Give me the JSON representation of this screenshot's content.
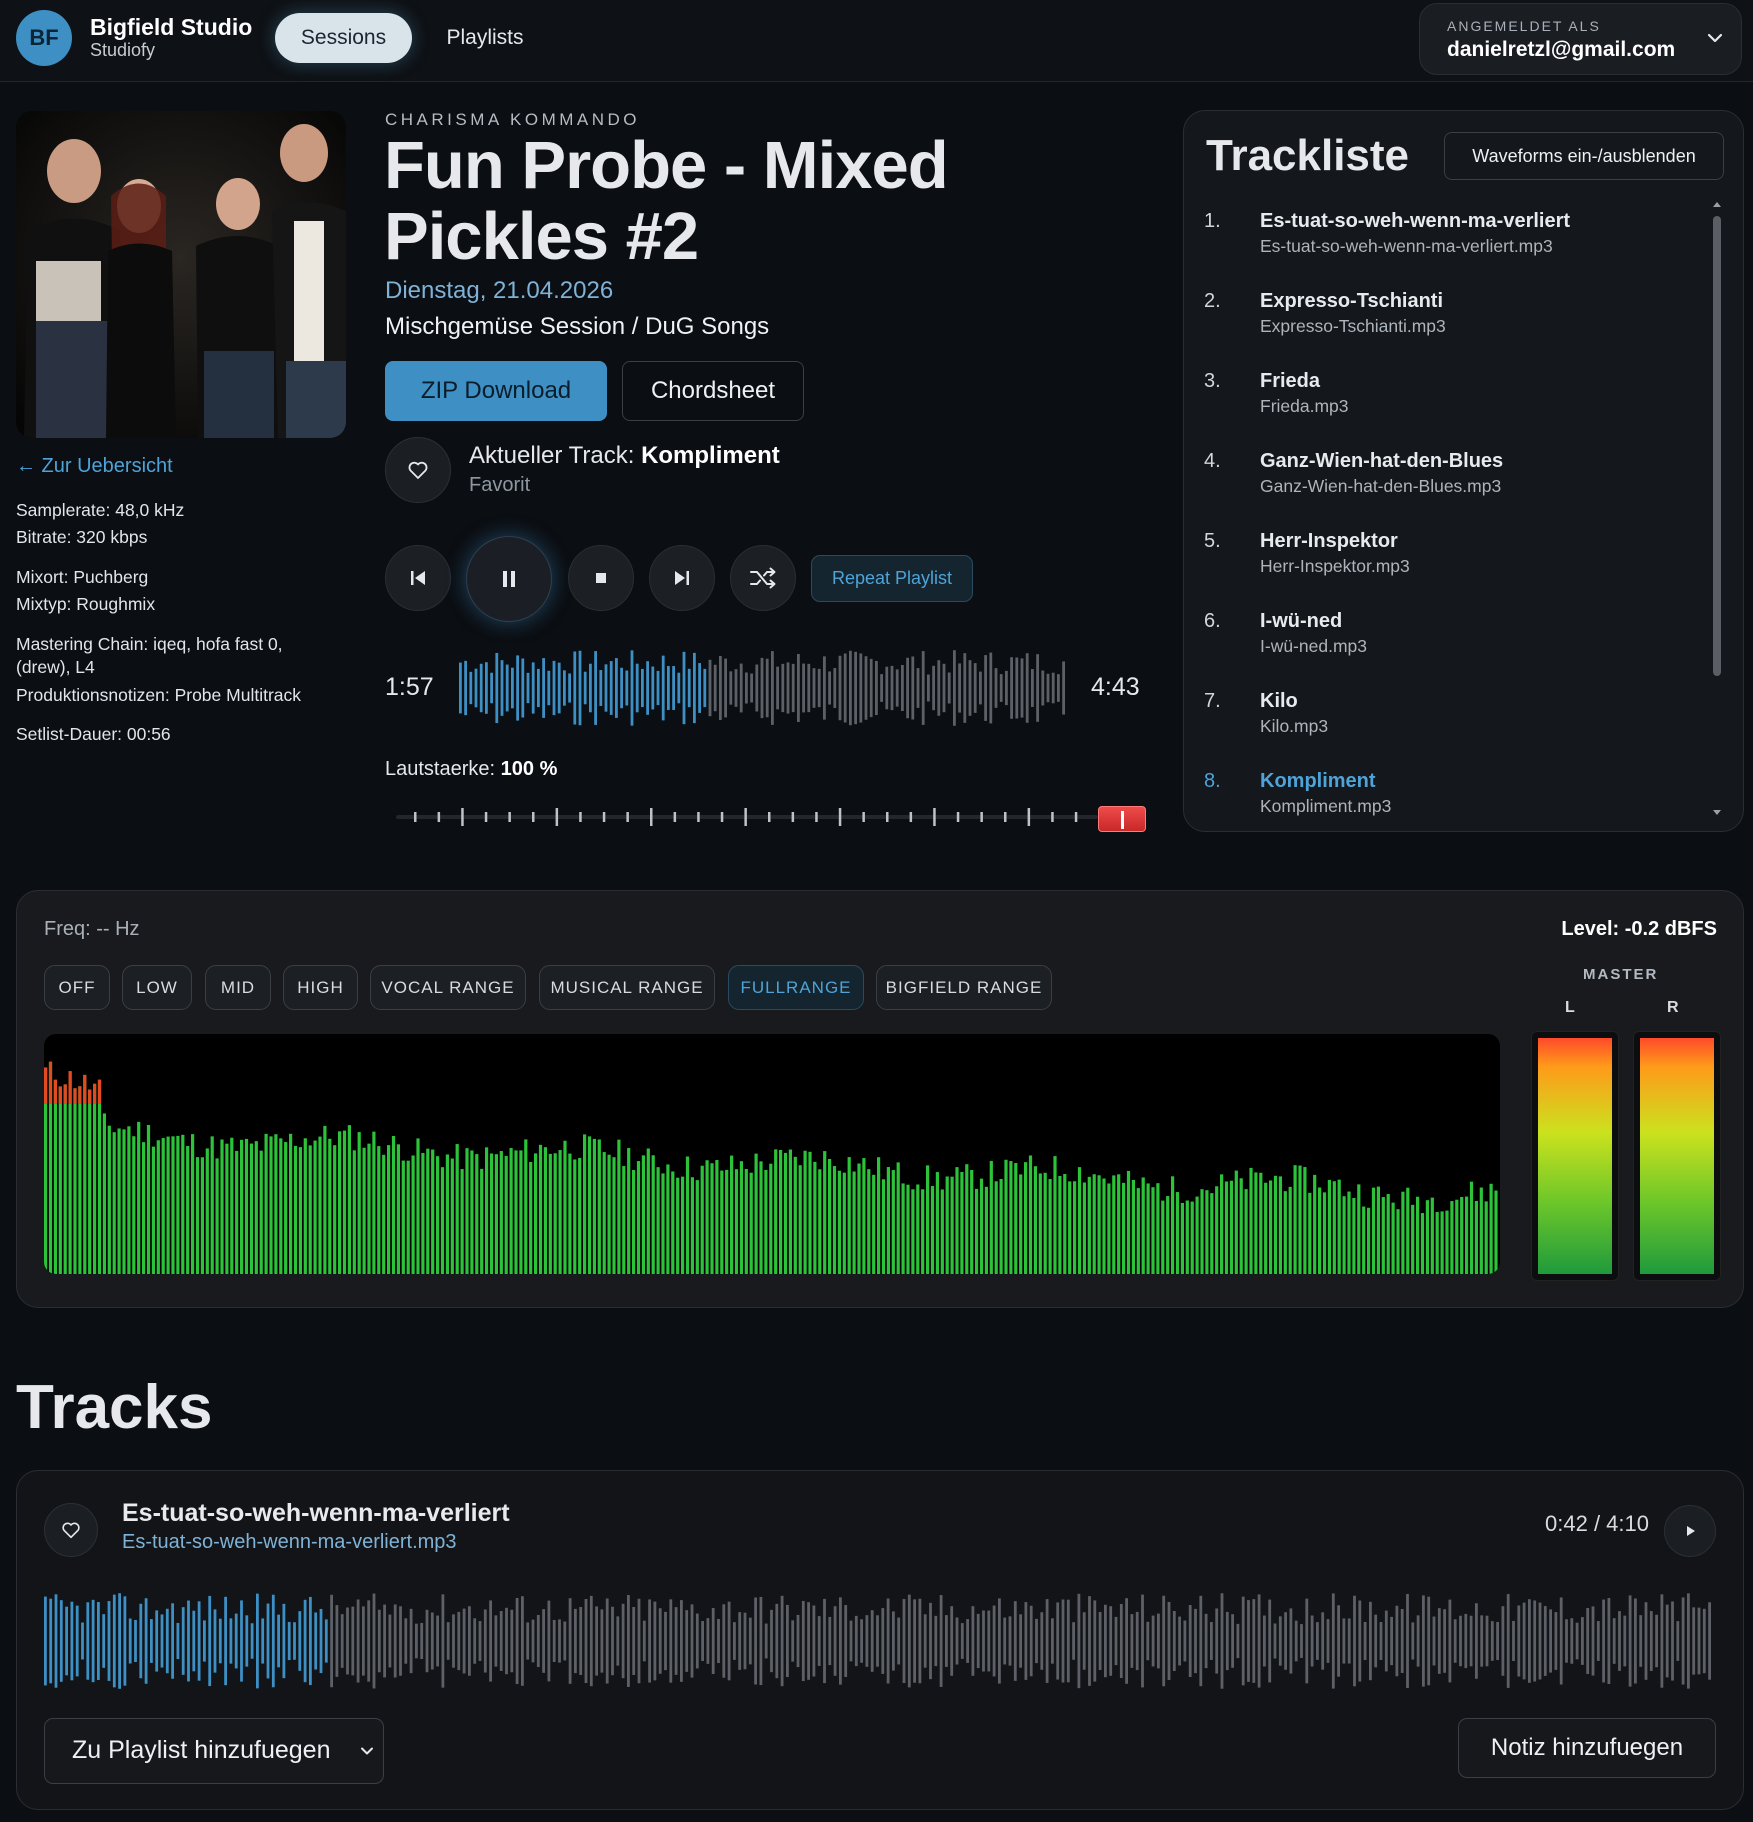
{
  "brand": {
    "badge": "BF",
    "name": "Bigfield Studio",
    "subtitle": "Studiofy"
  },
  "nav": {
    "items": [
      {
        "label": "Sessions",
        "active": true
      },
      {
        "label": "Playlists",
        "active": false
      }
    ]
  },
  "account": {
    "label": "ANGEMELDET ALS",
    "email": "danielretzl@gmail.com"
  },
  "session": {
    "band": "CHARISMA KOMMANDO",
    "title": "Fun Probe - Mixed Pickles #2",
    "date": "Dienstag, 21.04.2026",
    "subtitle": "Mischgemüse Session / DuG Songs",
    "back_link": "← Zur Uebersicht",
    "meta": {
      "samplerate": "Samplerate: 48,0 kHz",
      "bitrate": "Bitrate: 320 kbps",
      "mixort": "Mixort: Puchberg",
      "mixtyp": "Mixtyp: Roughmix",
      "mastering1": "Mastering Chain: iqeq, hofa fast 0,",
      "mastering2": "(drew), L4",
      "notes": "Produktionsnotizen: Probe Multitrack",
      "setlist": "Setlist-Dauer: 00:56"
    }
  },
  "actions": {
    "zip": "ZIP Download",
    "chordsheet": "Chordsheet"
  },
  "player": {
    "current_prefix": "Aktueller Track:",
    "current_track": "Kompliment",
    "favorite_label": "Favorit",
    "repeat": "Repeat Playlist",
    "time_current": "1:57",
    "time_total": "4:43",
    "progress": 0.41,
    "volume_label": "Lautstaerke:",
    "volume_value": "100 %",
    "volume": 1.0,
    "accent": "#3d8fc4"
  },
  "tracklist": {
    "title": "Trackliste",
    "toggle": "Waveforms ein-/ausblenden",
    "items": [
      {
        "num": "1.",
        "name": "Es-tuat-so-weh-wenn-ma-verliert",
        "file": "Es-tuat-so-weh-wenn-ma-verliert.mp3"
      },
      {
        "num": "2.",
        "name": "Expresso-Tschianti",
        "file": "Expresso-Tschianti.mp3"
      },
      {
        "num": "3.",
        "name": "Frieda",
        "file": "Frieda.mp3"
      },
      {
        "num": "4.",
        "name": "Ganz-Wien-hat-den-Blues",
        "file": "Ganz-Wien-hat-den-Blues.mp3"
      },
      {
        "num": "5.",
        "name": "Herr-Inspektor",
        "file": "Herr-Inspektor.mp3"
      },
      {
        "num": "6.",
        "name": "I-wü-ned",
        "file": "I-wü-ned.mp3"
      },
      {
        "num": "7.",
        "name": "Kilo",
        "file": "Kilo.mp3"
      },
      {
        "num": "8.",
        "name": "Kompliment",
        "file": "Kompliment.mp3"
      }
    ],
    "active_index": 7
  },
  "analyzer": {
    "freq": "Freq: -- Hz",
    "level": "Level: -0.2 dBFS",
    "bands": [
      "OFF",
      "LOW",
      "MID",
      "HIGH",
      "VOCAL RANGE",
      "MUSICAL RANGE",
      "FULLRANGE",
      "BIGFIELD RANGE"
    ],
    "active_band": "FULLRANGE",
    "master_label": "MASTER",
    "channel_left": "L",
    "channel_right": "R",
    "meter_left": 1.0,
    "meter_right": 1.0
  },
  "tracks_section": {
    "heading": "Tracks",
    "card": {
      "name": "Es-tuat-so-weh-wenn-ma-verliert",
      "file": "Es-tuat-so-weh-wenn-ma-verliert.mp3",
      "time": "0:42 / 4:10",
      "progress": 0.17,
      "playlist_select": "Zu Playlist hinzufuegen",
      "note_button": "Notiz hinzufuegen"
    }
  },
  "icons": {
    "heart": "heart-icon",
    "prev": "skip-back-icon",
    "pause": "pause-icon",
    "stop": "stop-icon",
    "next": "skip-forward-icon",
    "shuffle": "shuffle-icon",
    "play": "play-icon",
    "chevron": "chevron-down-icon"
  }
}
